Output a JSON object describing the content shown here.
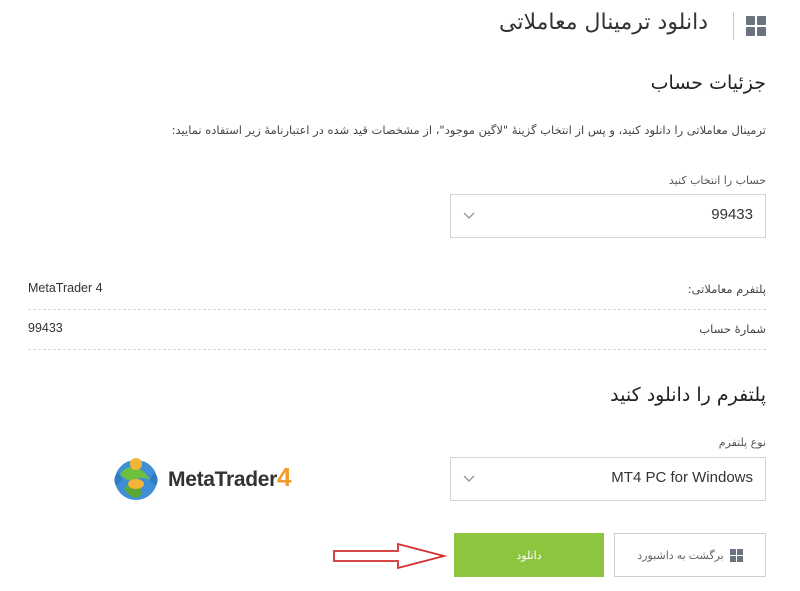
{
  "header": {
    "title": "دانلود ترمینال معاملاتی",
    "icon": "dashboard-grid-icon"
  },
  "account_section": {
    "title": "جزئیات حساب",
    "instruction": "ترمینال معاملاتی را دانلود کنید، و پس از انتخاب گزینهٔ \"لاگین موجود\"، از مشخصات قید شده در اعتبارنامهٔ زیر استفاده نمایید:",
    "select_label": "حساب را انتخاب کنید",
    "selected_account": "99433",
    "rows": [
      {
        "label": "پلتفرم معاملاتی:",
        "value": "MetaTrader 4"
      },
      {
        "label": "شمارهٔ حساب",
        "value": "99433"
      }
    ]
  },
  "download_section": {
    "title": "پلتفرم را دانلود کنید",
    "platform_label": "نوع پلتفرم",
    "selected_platform": "MT4 PC for Windows",
    "logo_text": "MetaTrader",
    "logo_number": "4"
  },
  "buttons": {
    "download": "دانلود",
    "back": "برگشت به داشبورد"
  },
  "colors": {
    "accent_green": "#8cc63f",
    "arrow_red": "#d32f2f",
    "logo_orange": "#f29a2e"
  }
}
